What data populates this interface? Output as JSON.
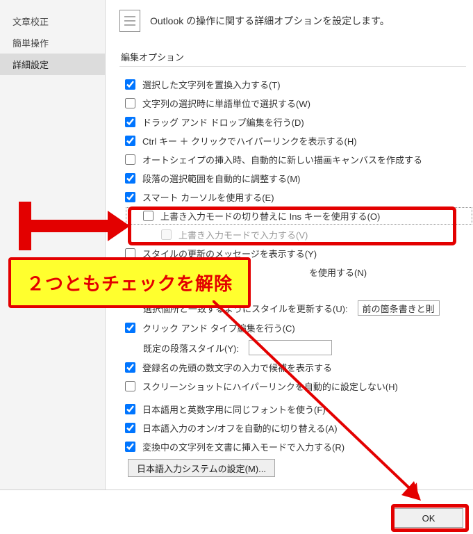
{
  "sidebar": {
    "items": [
      {
        "label": "文章校正"
      },
      {
        "label": "簡単操作"
      },
      {
        "label": "詳細設定"
      }
    ],
    "selected_index": 2
  },
  "header": {
    "title": "Outlook の操作に関する詳細オプションを設定します。"
  },
  "group_title": "編集オプション",
  "options": {
    "replace_typing": {
      "label": "選択した文字列を置換入力する(T)",
      "checked": true
    },
    "word_select": {
      "label": "文字列の選択時に単語単位で選択する(W)",
      "checked": false
    },
    "drag_drop": {
      "label": "ドラッグ アンド ドロップ編集を行う(D)",
      "checked": true
    },
    "ctrl_click": {
      "label": "Ctrl キー ＋ クリックでハイパーリンクを表示する(H)",
      "checked": true
    },
    "autoshape_canvas": {
      "label": "オートシェイプの挿入時、自動的に新しい描画キャンバスを作成する",
      "checked": false
    },
    "para_select": {
      "label": "段落の選択範囲を自動的に調整する(M)",
      "checked": true
    },
    "smart_cursor": {
      "label": "スマート カーソルを使用する(E)",
      "checked": true
    },
    "ins_toggle": {
      "label": "上書き入力モードの切り替えに Ins キーを使用する(O)",
      "checked": false
    },
    "overtype": {
      "label": "上書き入力モードで入力する(V)",
      "checked": false
    },
    "style_update_msg": {
      "label": "スタイルの更新のメッセージを表示する(Y)",
      "checked": false
    },
    "normal_style": {
      "label": "を使用する(N)",
      "checked": false
    },
    "style_update_row": {
      "label": "選択個所と一致するようにスタイルを更新する(U):",
      "combo": "前の箇条書きと則"
    },
    "click_type": {
      "label": "クリック アンド タイプ編集を行う(C)",
      "checked": true
    },
    "default_para": {
      "label": "既定の段落スタイル(Y):",
      "combo": ""
    },
    "register_ime": {
      "label": "登録名の先頭の数文字の入力で候補を表示する",
      "checked": true
    },
    "screenshot_link": {
      "label": "スクリーンショットにハイパーリンクを自動的に設定しない(H)",
      "checked": false
    },
    "same_font": {
      "label": "日本語用と英数字用に同じフォントを使う(F)",
      "checked": true
    },
    "ime_auto": {
      "label": "日本語入力のオン/オフを自動的に切り替える(A)",
      "checked": true
    },
    "insert_mode": {
      "label": "変換中の文字列を文書に挿入モードで入力する(R)",
      "checked": true
    }
  },
  "ime_button": "日本語入力システムの設定(M)...",
  "ok_button": "OK",
  "annotation": {
    "uncheck_both": "２つともチェックを解除"
  }
}
